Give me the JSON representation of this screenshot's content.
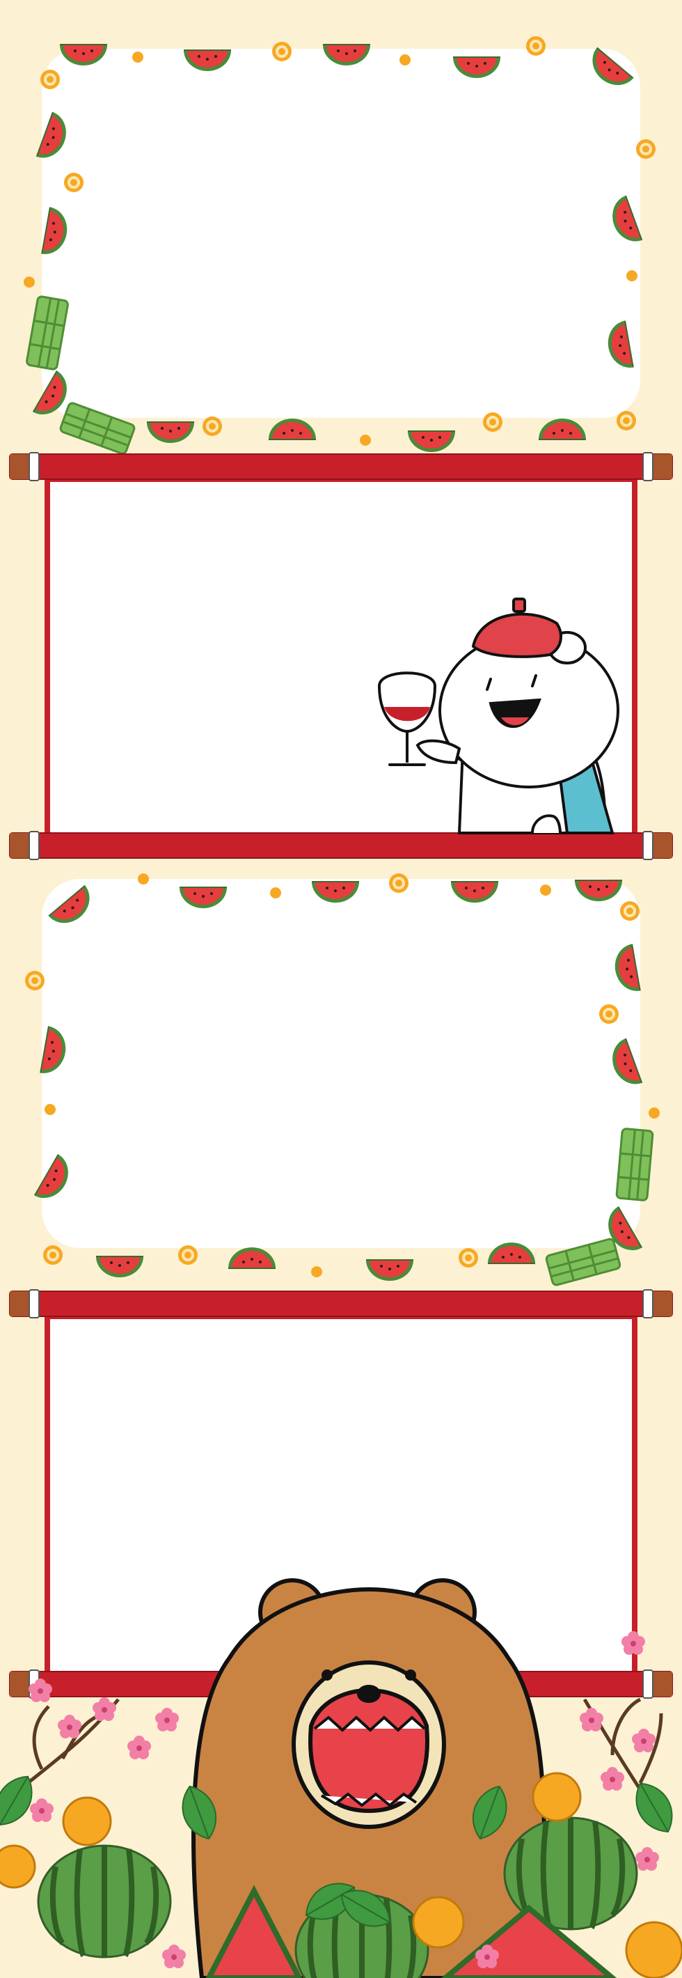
{
  "photo_strip": {
    "frame_count": 4,
    "frames": [
      {
        "style": "watermelon-confetti",
        "photo": "empty"
      },
      {
        "style": "red-scroll",
        "photo": "empty",
        "decoration": "bear-with-wine"
      },
      {
        "style": "watermelon-confetti",
        "photo": "empty"
      },
      {
        "style": "red-scroll",
        "photo": "empty",
        "decoration": "brown-bear"
      }
    ]
  },
  "colors": {
    "background": "#fdf1d3",
    "scroll_red": "#c8202b",
    "scroll_end_wood": "#a8552c",
    "watermelon_red": "#e63e3e",
    "watermelon_rind": "#4a8b3a",
    "coin_orange": "#f7a823",
    "bear_brown": "#c98444",
    "scarf_teal": "#5cbfd0",
    "cap_red": "#e0434a",
    "blossom_pink": "#f27fa6",
    "leaf_green": "#3f9a40"
  },
  "icons": [
    "watermelon-slice-icon",
    "gold-coin-icon",
    "banh-chung-icon",
    "wine-glass-icon",
    "bear-icon",
    "plum-blossom-icon",
    "whole-watermelon-icon"
  ]
}
